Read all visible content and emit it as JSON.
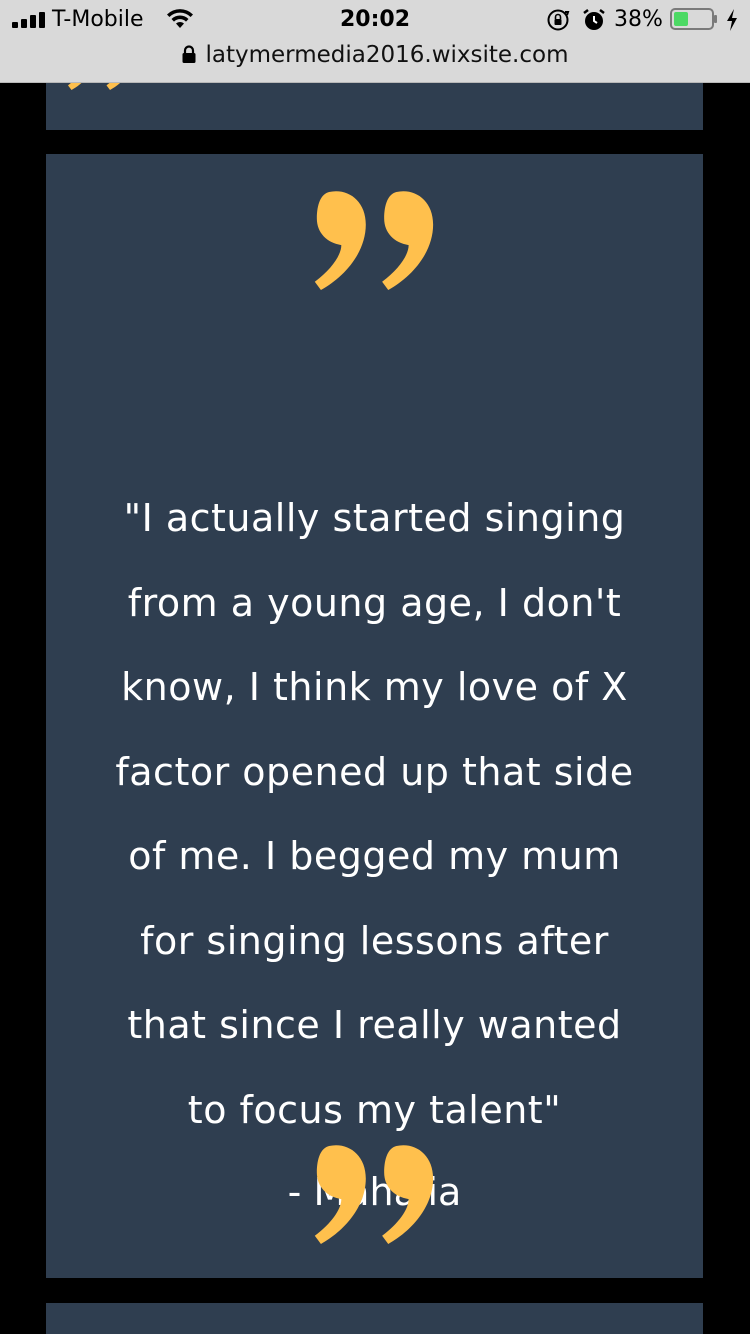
{
  "status_bar": {
    "carrier": "T-Mobile",
    "time": "20:02",
    "battery_percent": "38%",
    "battery_level": 0.38,
    "icons": [
      "signal-bars-icon",
      "wifi-icon",
      "rotation-lock-icon",
      "alarm-icon",
      "battery-icon",
      "charging-bolt-icon"
    ]
  },
  "browser": {
    "url": "latymermedia2016.wixsite.com",
    "icons": [
      "padlock-icon"
    ]
  },
  "quote": {
    "lines": [
      "\"I actually started singing",
      "from a young age, I don't",
      "know, I think my love of X",
      "factor opened up that side",
      "of me. I begged my mum",
      "for singing lessons after",
      "that since I really wanted",
      "to focus my talent\""
    ],
    "attribution": "- Mahalia"
  },
  "colors": {
    "panel_bg": "#2f3e50",
    "quote_mark": "#ffc04d",
    "page_bg": "#000000",
    "text": "#ffffff"
  }
}
